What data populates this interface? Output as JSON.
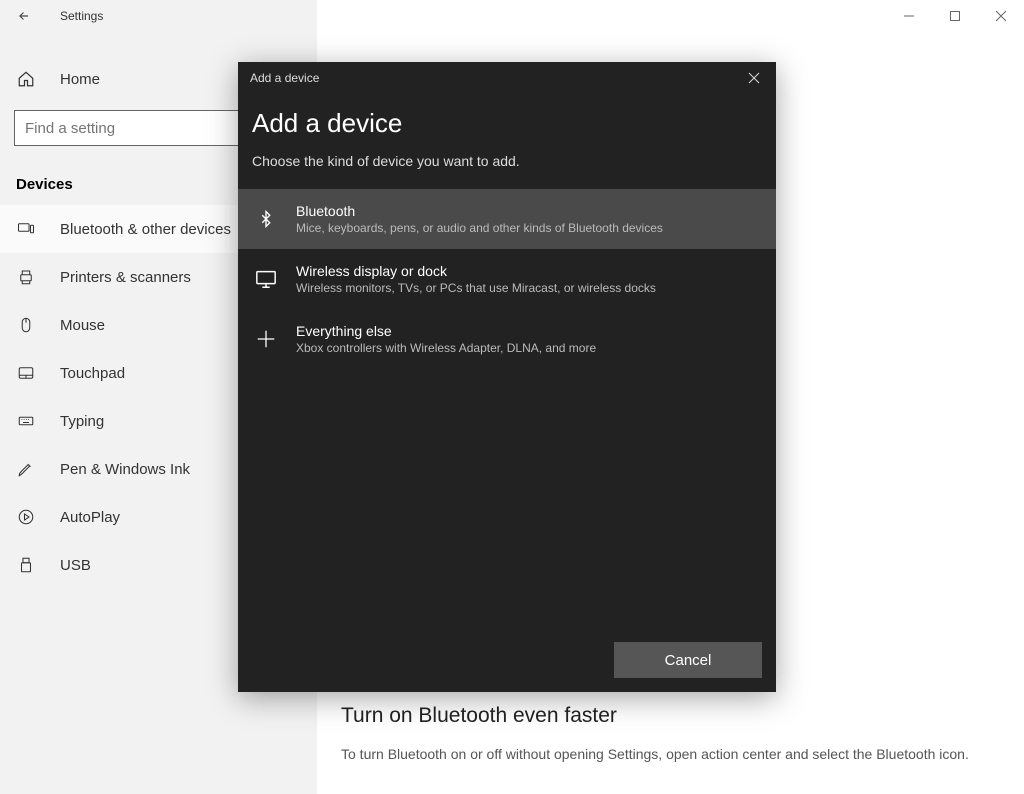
{
  "titlebar": {
    "title": "Settings"
  },
  "sidebar": {
    "home_label": "Home",
    "search_placeholder": "Find a setting",
    "section_heading": "Devices",
    "items": [
      {
        "label": "Bluetooth & other devices"
      },
      {
        "label": "Printers & scanners"
      },
      {
        "label": "Mouse"
      },
      {
        "label": "Touchpad"
      },
      {
        "label": "Typing"
      },
      {
        "label": "Pen & Windows Ink"
      },
      {
        "label": "AutoPlay"
      },
      {
        "label": "USB"
      }
    ]
  },
  "content": {
    "subtitle": "Turn on Bluetooth even faster",
    "text": "To turn Bluetooth on or off without opening Settings, open action center and select the Bluetooth icon."
  },
  "modal": {
    "chrome_title": "Add a device",
    "title": "Add a device",
    "subtitle": "Choose the kind of device you want to add.",
    "options": [
      {
        "title": "Bluetooth",
        "desc": "Mice, keyboards, pens, or audio and other kinds of Bluetooth devices"
      },
      {
        "title": "Wireless display or dock",
        "desc": "Wireless monitors, TVs, or PCs that use Miracast, or wireless docks"
      },
      {
        "title": "Everything else",
        "desc": "Xbox controllers with Wireless Adapter, DLNA, and more"
      }
    ],
    "cancel_label": "Cancel"
  }
}
